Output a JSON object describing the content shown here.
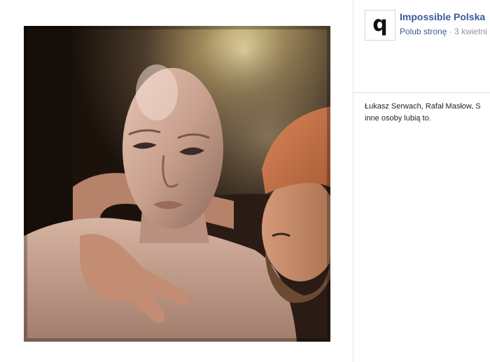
{
  "post": {
    "page_name": "Impossible Polska",
    "avatar_glyph": "q",
    "like_page": "Polub stronę",
    "separator": " · ",
    "date": "3 kwietni"
  },
  "likes": {
    "line1": "Łukasz Serwach, Rafał Masłow, S",
    "line2": "inne osoby lubią to."
  },
  "photo": {
    "description_icon": "polaroid-photo"
  }
}
